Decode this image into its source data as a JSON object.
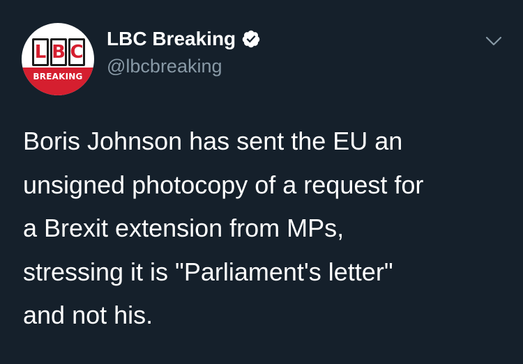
{
  "tweet": {
    "author": {
      "display_name": "LBC Breaking",
      "handle": "@lbcbreaking",
      "verified": true,
      "avatar": {
        "logo_letters": [
          "L",
          "B",
          "C"
        ],
        "banner_text": "BREAKING"
      }
    },
    "text_lines": [
      "Boris Johnson has sent the EU an",
      "unsigned photocopy of a request for",
      "a Brexit extension from MPs,",
      "stressing it is \"Parliament's letter\"",
      "and not his."
    ],
    "icons": {
      "verified": "verified-badge-icon",
      "menu": "chevron-down-icon"
    }
  },
  "colors": {
    "background": "#15202b",
    "text": "#ffffff",
    "secondary_text": "#8899a6",
    "brand_red": "#d51f2f",
    "caret": "#8899a6"
  }
}
